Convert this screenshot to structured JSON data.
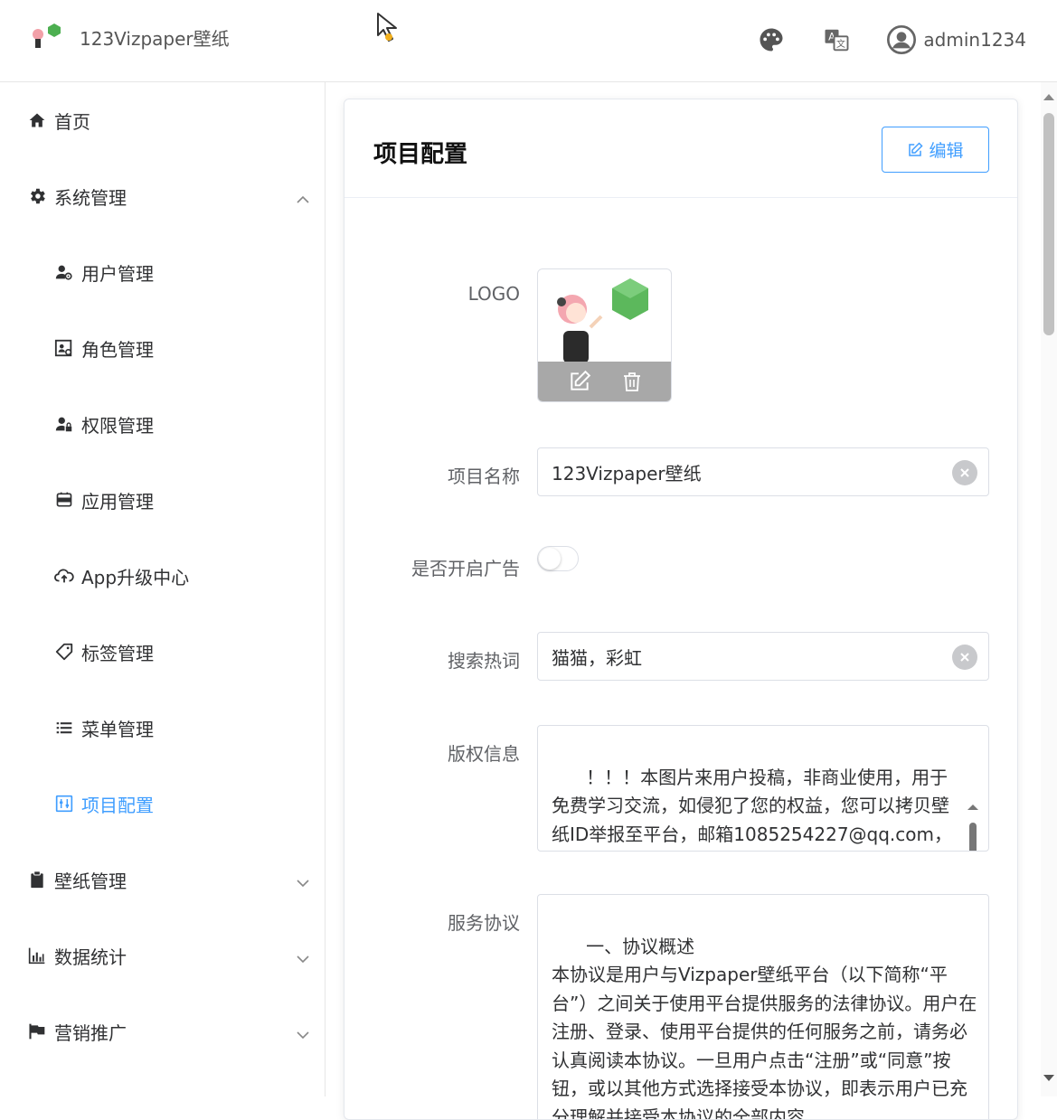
{
  "header": {
    "app_title": "123Vizpaper壁纸",
    "username": "admin1234",
    "icons": [
      "palette-icon",
      "translate-icon",
      "user-avatar-icon"
    ]
  },
  "sidebar": {
    "items": [
      {
        "label": "首页",
        "icon": "home-icon",
        "level": 1
      },
      {
        "label": "系统管理",
        "icon": "gear-icon",
        "level": 1,
        "expanded": true
      },
      {
        "label": "用户管理",
        "icon": "user-settings-icon",
        "level": 2
      },
      {
        "label": "角色管理",
        "icon": "role-icon",
        "level": 2
      },
      {
        "label": "权限管理",
        "icon": "user-lock-icon",
        "level": 2
      },
      {
        "label": "应用管理",
        "icon": "app-icon",
        "level": 2
      },
      {
        "label": "App升级中心",
        "icon": "cloud-upload-icon",
        "level": 2
      },
      {
        "label": "标签管理",
        "icon": "tag-icon",
        "level": 2
      },
      {
        "label": "菜单管理",
        "icon": "list-icon",
        "level": 2
      },
      {
        "label": "项目配置",
        "icon": "config-icon",
        "level": 2,
        "active": true
      },
      {
        "label": "壁纸管理",
        "icon": "clipboard-icon",
        "level": 1,
        "expanded": false
      },
      {
        "label": "数据统计",
        "icon": "bar-chart-icon",
        "level": 1,
        "expanded": false
      },
      {
        "label": "营销推广",
        "icon": "flag-icon",
        "level": 1,
        "expanded": false
      }
    ]
  },
  "main": {
    "card_title": "项目配置",
    "edit_label": "编辑",
    "form": {
      "logo_label": "LOGO",
      "name_label": "项目名称",
      "name_value": "123Vizpaper壁纸",
      "ads_label": "是否开启广告",
      "ads_enabled": false,
      "hotwords_label": "搜索热词",
      "hotwords_value": "猫猫，彩虹",
      "copyright_label": "版权信息",
      "copyright_value": "！！！本图片来用户投稿，非商业使用，用于免费学习交流，如侵犯了您的权益，您可以拷贝壁纸ID举报至平台，邮箱1085254227@qq.com，管理将删除侵权壁纸，维护您的权益。",
      "terms_label": "服务协议",
      "terms_value": "一、协议概述\n本协议是用户与Vizpaper壁纸平台（以下简称“平台”）之间关于使用平台提供服务的法律协议。用户在注册、登录、使用平台提供的任何服务之前，请务必认真阅读本协议。一旦用户点击“注册”或“同意”按钮，或以其他方式选择接受本协议，即表示用户已充分理解并接受本协议的全部内容。"
    }
  },
  "colors": {
    "accent": "#409eff",
    "border": "#dcdfe6",
    "label": "#606266"
  }
}
